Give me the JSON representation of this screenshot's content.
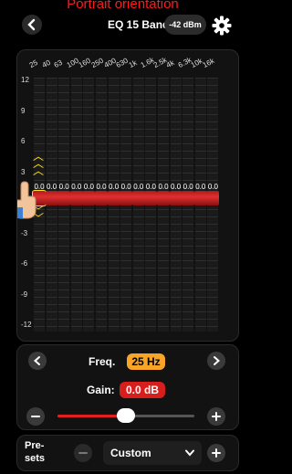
{
  "caption": "Portrait orientation",
  "header": {
    "title": "EQ 15 Bands",
    "level": "-42 dBm",
    "back_icon": "chevron-left-icon",
    "settings_icon": "gear-icon"
  },
  "eq": {
    "frequencies": [
      "25",
      "40",
      "63",
      "100",
      "160",
      "250",
      "400",
      "630",
      "1k",
      "1.6k",
      "2.5k",
      "4k",
      "6.3k",
      "10k",
      "16k"
    ],
    "y_ticks": [
      "12",
      "9",
      "6",
      "3",
      "0",
      "-3",
      "-6",
      "-9",
      "-12"
    ],
    "band_values": [
      "0.0",
      "0.0",
      "0.0",
      "0.0",
      "0.0",
      "0.0",
      "0.0",
      "0.0",
      "0.0",
      "0.0",
      "0.0",
      "0.0",
      "0.0",
      "0.0",
      "0.0"
    ],
    "selected_band": 0,
    "handle_color": "#d42424"
  },
  "controls": {
    "freq_label": "Freq.",
    "freq_value": "25 Hz",
    "gain_label": "Gain:",
    "gain_value": "0.0 dB",
    "gain_slider_fraction": 0.5,
    "prev_icon": "chevron-left-icon",
    "next_icon": "chevron-right-icon",
    "minus_icon": "minus-icon",
    "plus_icon": "plus-icon"
  },
  "presets": {
    "label_line1": "Pre-",
    "label_line2": "sets",
    "selected": "Custom"
  },
  "colors": {
    "accent_orange": "#f7a427",
    "accent_red": "#d81d1d"
  }
}
